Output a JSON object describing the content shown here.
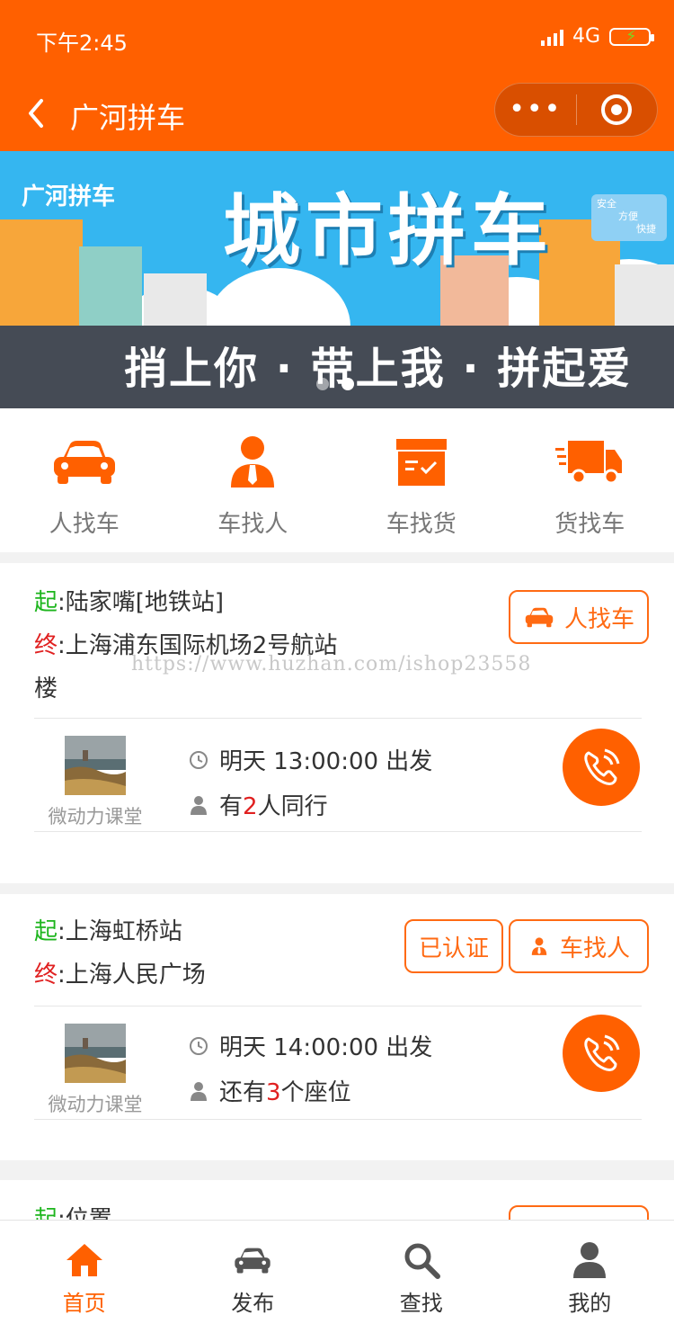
{
  "status_bar": {
    "time": "下午2:45",
    "network": "4G"
  },
  "nav": {
    "title": "广河拼车",
    "more": "•••"
  },
  "banner": {
    "brand": "广河拼车",
    "headline": "城市拼车",
    "slogan": "捎上你 · 带上我 · 拼起爱",
    "badge_lines": [
      "安全",
      "方便",
      "快捷"
    ],
    "active_dot": 2,
    "dot_count": 2
  },
  "menu": [
    {
      "label": "人找车",
      "icon": "car-icon"
    },
    {
      "label": "车找人",
      "icon": "driver-icon"
    },
    {
      "label": "车找货",
      "icon": "cargo-box-icon"
    },
    {
      "label": "货找车",
      "icon": "truck-icon"
    }
  ],
  "watermark": "https://www.huzhan.com/ishop23558",
  "posts": [
    {
      "start_label": "起",
      "start": ":陆家嘴[地铁站]",
      "end_label": "终",
      "end": ":上海浦东国际机场2号航站",
      "end_wrap": "楼",
      "tags": [
        {
          "label": "人找车",
          "icon": "car-icon"
        }
      ],
      "user": "微动力课堂",
      "time": "明天 13:00:00 出发",
      "seat_pre": "有",
      "seat_num": "2",
      "seat_post": "人同行"
    },
    {
      "start_label": "起",
      "start": ":上海虹桥站",
      "end_label": "终",
      "end": ":上海人民广场",
      "tags": [
        {
          "label": "已认证",
          "icon": ""
        },
        {
          "label": "车找人",
          "icon": "driver-icon"
        }
      ],
      "user": "微动力课堂",
      "time": "明天 14:00:00 出发",
      "seat_pre": "还有",
      "seat_num": "3",
      "seat_post": "个座位"
    },
    {
      "start_label": "起",
      "start": ":位置"
    }
  ],
  "tabbar": [
    {
      "label": "首页",
      "icon": "home-icon",
      "active": true
    },
    {
      "label": "发布",
      "icon": "car-icon",
      "active": false
    },
    {
      "label": "查找",
      "icon": "search-icon",
      "active": false
    },
    {
      "label": "我的",
      "icon": "user-icon",
      "active": false
    }
  ],
  "colors": {
    "primary": "#ff6000",
    "start": "#1db51d",
    "end": "#e02020"
  }
}
